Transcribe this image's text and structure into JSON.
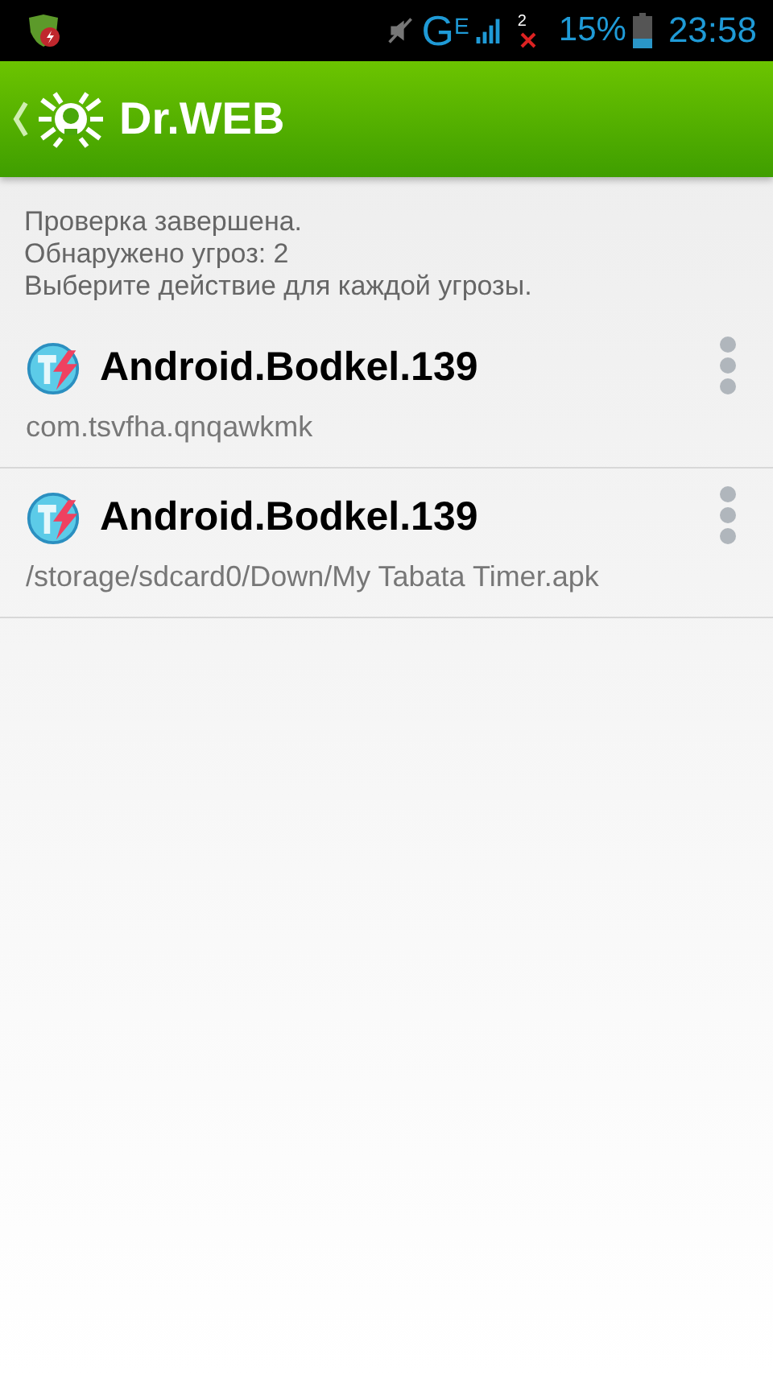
{
  "status_bar": {
    "network": "G",
    "network_sub": "E",
    "sim_label": "2",
    "battery": "15%",
    "time": "23:58"
  },
  "app_bar": {
    "title": "Dr.WEB"
  },
  "summary": [
    "Проверка завершена.",
    "Обнаружено угроз: 2",
    "Выберите действие для каждой угрозы."
  ],
  "threats": [
    {
      "name": "Android.Bodkel.139",
      "path": "com.tsvfha.qnqawkmk"
    },
    {
      "name": "Android.Bodkel.139",
      "path": "/storage/sdcard0/Down/My Tabata Timer.apk"
    }
  ]
}
